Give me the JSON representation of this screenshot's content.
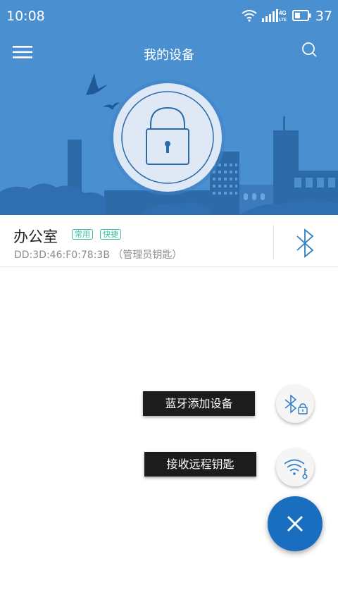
{
  "status_bar": {
    "time": "10:08",
    "network": "4G LTE",
    "battery": "37"
  },
  "header": {
    "title": "我的设备"
  },
  "device": {
    "name": "办公室",
    "tags": [
      "常用",
      "快捷"
    ],
    "mac": "DD:3D:46:F0:78:3B",
    "role": "（管理员钥匙）"
  },
  "actions": {
    "add_bluetooth_label": "蓝牙添加设备",
    "receive_remote_key_label": "接收远程钥匙"
  },
  "colors": {
    "hero_bg": "#4a8fd0",
    "accent": "#1a6ec0",
    "tag": "#35bfa3"
  }
}
